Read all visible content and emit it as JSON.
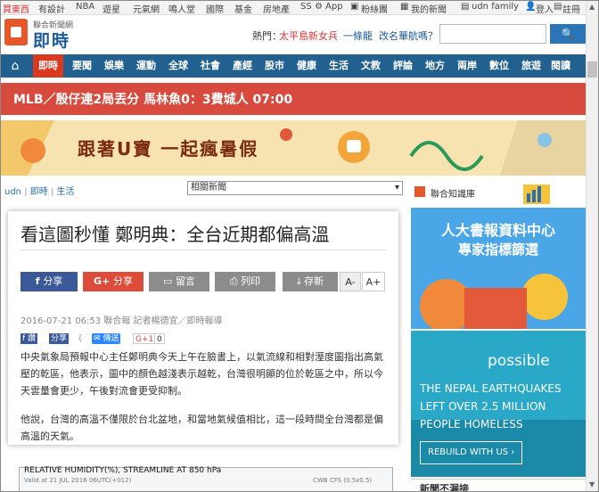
{
  "topbar": {
    "items": [
      "買東西",
      "有設計",
      "NBA",
      "遊星",
      "元氣網",
      "鳴人堂",
      "國際",
      "基金",
      "房地產",
      "SS",
      "App",
      "粉絲團",
      "我的新聞",
      "udn family",
      "登入",
      "註冊"
    ]
  },
  "header": {
    "brand_small": "聯合新聞網",
    "brand_big": "即時",
    "hot_label": "熱門：",
    "hot_links": [
      "太平島新女兵",
      "一條龍",
      "改名華航嗎？"
    ],
    "search_placeholder": "",
    "search_button": "搜尋"
  },
  "nav": {
    "home_icon": "home-icon",
    "items": [
      "即時",
      "要聞",
      "娛樂",
      "運動",
      "全球",
      "社會",
      "產經",
      "股市",
      "健康",
      "生活",
      "文教",
      "評論",
      "地方",
      "兩岸",
      "數位",
      "旅遊",
      "閱讀"
    ],
    "active": "即時"
  },
  "ticker": {
    "text": "MLB／殷仔連2局丟分 馬林魚0：3費城人 07:00"
  },
  "banner": {
    "text": "跟著U寶 一起瘋暑假"
  },
  "breadcrumb": [
    "udn",
    "即時",
    "生活"
  ],
  "related": {
    "label": "相關新聞"
  },
  "article": {
    "title": "看這圖秒懂 鄭明典：全台近期都偏高溫",
    "buttons": {
      "facebook_share": "分享",
      "gplus_share": "分享",
      "comment": "留言",
      "print": "列印",
      "save": "存新",
      "font_down": "A-",
      "font_up": "A+"
    },
    "meta": "2016-07-21 06:53 聯合報 記者楊德宜／即時報導",
    "mini_buttons": [
      "讚",
      "分享",
      "傳送",
      "G+1",
      "0"
    ],
    "paragraphs": [
      "中央氣象局預報中心主任鄭明典今天上午在臉書上，以氣流線和相對溼度圖指出高氣壓的乾區，他表示，圖中的顏色越淺表示越乾，台灣很明顯的位於乾區之中，所以今天雲量會更少，午後對流會更受抑制。",
      "他說，台灣的高溫不僅限於台北盆地，和當地氣候值相比，這一段時間全台灣都是偏高溫的天氣。"
    ],
    "chart_caption_left": "RELATIVE HUMIDITY(%), STREAMLINE AT 850 hPa",
    "chart_caption_sub": "Valid at 21 JUL 2016 06UTC(+012)",
    "chart_caption_right": "CWB CFS (0.5x0.5)"
  },
  "sidebar": {
    "ad1_brand": "聯合知識庫",
    "ad1_title": "人大書報資料中心",
    "ad1_subtitle": "專家指標篩選",
    "ad2_brand": "possible",
    "ad2_lines": [
      "THE NEPAL EARTHQUAKES",
      "LEFT OVER 2.5 MILLION",
      "PEOPLE HOMELESS"
    ],
    "ad2_button": "REBUILD WITH US",
    "next_heading": "新聞不漏接"
  },
  "colors": {
    "nav_bg": "#22608f",
    "nav_active": "#d9391f",
    "ticker_bg": "#d84a3d",
    "facebook": "#3b5998",
    "gplus": "#dd4b39",
    "gray_button": "#8c8c8c"
  }
}
